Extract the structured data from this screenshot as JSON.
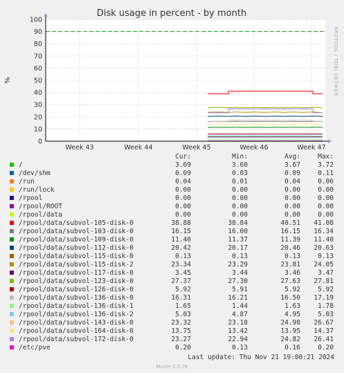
{
  "chart_data": {
    "type": "line",
    "title": "Disk usage in percent - by month",
    "ylabel": "%",
    "xlabel": "",
    "ylim": [
      0,
      100
    ],
    "yticks": [
      0,
      10,
      20,
      30,
      40,
      50,
      60,
      70,
      80,
      90,
      100
    ],
    "xticks": [
      "Week 43",
      "Week 44",
      "Week 45",
      "Week 46",
      "Week 47"
    ],
    "warning_line": 90,
    "grid": true,
    "columns": {
      "cur": "Cur:",
      "min": "Min:",
      "avg": "Avg:",
      "max": "Max:"
    },
    "series": [
      {
        "name": "/",
        "color": "#00cc00",
        "cur": "3.69",
        "min": "3.60",
        "avg": "3.67",
        "max": "3.72"
      },
      {
        "name": "/dev/shm",
        "color": "#0066b3",
        "cur": "0.09",
        "min": "0.03",
        "avg": "0.09",
        "max": "0.11"
      },
      {
        "name": "/run",
        "color": "#ff8000",
        "cur": "0.04",
        "min": "0.01",
        "avg": "0.04",
        "max": "0.06"
      },
      {
        "name": "/run/lock",
        "color": "#ffcc00",
        "cur": "0.00",
        "min": "0.00",
        "avg": "0.00",
        "max": "0.00"
      },
      {
        "name": "/rpool",
        "color": "#330099",
        "cur": "0.00",
        "min": "0.00",
        "avg": "0.00",
        "max": "0.00"
      },
      {
        "name": "/rpool/ROOT",
        "color": "#990099",
        "cur": "0.00",
        "min": "0.00",
        "avg": "0.00",
        "max": "0.00"
      },
      {
        "name": "/rpool/data",
        "color": "#ccff00",
        "cur": "0.00",
        "min": "0.00",
        "avg": "0.00",
        "max": "0.00"
      },
      {
        "name": "/rpool/data/subvol-105-disk-0",
        "color": "#ff0000",
        "cur": "38.88",
        "min": "38.84",
        "avg": "40.51",
        "max": "41.08"
      },
      {
        "name": "/rpool/data/subvol-103-disk-0",
        "color": "#808080",
        "cur": "16.15",
        "min": "16.00",
        "avg": "16.15",
        "max": "16.34"
      },
      {
        "name": "/rpool/data/subvol-109-disk-0",
        "color": "#008f00",
        "cur": "11.40",
        "min": "11.37",
        "avg": "11.39",
        "max": "11.40"
      },
      {
        "name": "/rpool/data/subvol-112-disk-0",
        "color": "#00487d",
        "cur": "20.42",
        "min": "20.17",
        "avg": "20.46",
        "max": "20.63"
      },
      {
        "name": "/rpool/data/subvol-115-disk-0",
        "color": "#b35a00",
        "cur": "0.13",
        "min": "0.13",
        "avg": "0.13",
        "max": "0.13"
      },
      {
        "name": "/rpool/data/subvol-115-disk-2",
        "color": "#b38f00",
        "cur": "23.34",
        "min": "23.29",
        "avg": "23.81",
        "max": "24.05"
      },
      {
        "name": "/rpool/data/subvol-117-disk-0",
        "color": "#6b006b",
        "cur": "3.45",
        "min": "3.44",
        "avg": "3.46",
        "max": "3.47"
      },
      {
        "name": "/rpool/data/subvol-123-disk-0",
        "color": "#8fb300",
        "cur": "27.37",
        "min": "27.30",
        "avg": "27.63",
        "max": "27.81"
      },
      {
        "name": "/rpool/data/subvol-126-disk-0",
        "color": "#b30000",
        "cur": "5.92",
        "min": "5.91",
        "avg": "5.92",
        "max": "5.92"
      },
      {
        "name": "/rpool/data/subvol-136-disk-0",
        "color": "#bebebe",
        "cur": "16.31",
        "min": "16.21",
        "avg": "16.50",
        "max": "17.19"
      },
      {
        "name": "/rpool/data/subvol-136-disk-1",
        "color": "#80ff80",
        "cur": "1.65",
        "min": "1.44",
        "avg": "1.63",
        "max": "1.78"
      },
      {
        "name": "/rpool/data/subvol-136-disk-2",
        "color": "#80c9ff",
        "cur": "5.03",
        "min": "4.87",
        "avg": "4.95",
        "max": "5.03"
      },
      {
        "name": "/rpool/data/subvol-143-disk-0",
        "color": "#ffc080",
        "cur": "23.32",
        "min": "23.18",
        "avg": "24.98",
        "max": "26.67"
      },
      {
        "name": "/rpool/data/subvol-164-disk-0",
        "color": "#ffe680",
        "cur": "13.75",
        "min": "13.42",
        "avg": "13.95",
        "max": "14.37"
      },
      {
        "name": "/rpool/data/subvol-172-disk-0",
        "color": "#aa80ff",
        "cur": "23.27",
        "min": "22.94",
        "avg": "24.82",
        "max": "26.41"
      },
      {
        "name": "/etc/pve",
        "color": "#ee00cc",
        "cur": "0.20",
        "min": "0.13",
        "avg": "0.16",
        "max": "0.20"
      }
    ]
  },
  "footer": {
    "last_update": "Last update: Thu Nov 21 19:00:21 2024",
    "version": "Munin 2.0.76",
    "rrd_credit": "RRDTOOL / TOBI OETIKER"
  }
}
